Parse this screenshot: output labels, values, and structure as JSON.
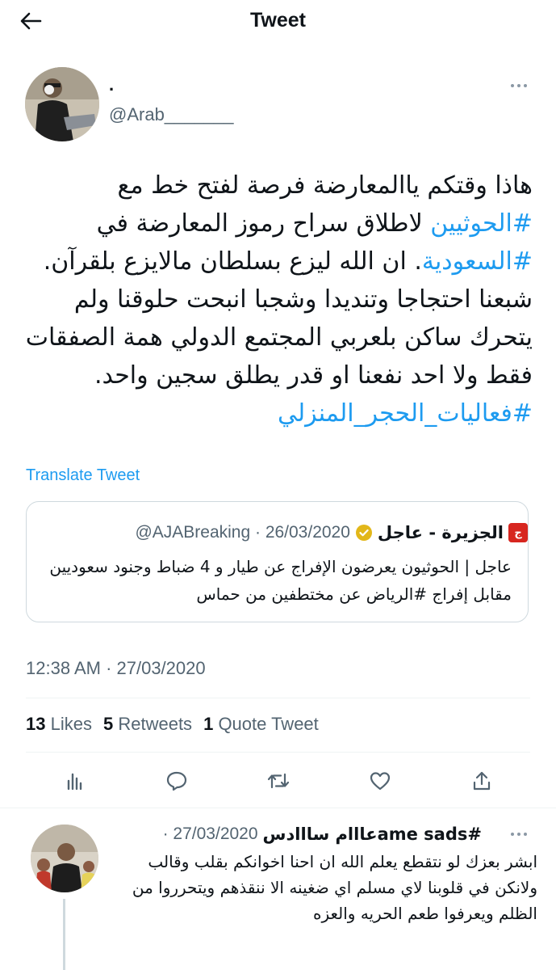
{
  "header": {
    "title": "Tweet"
  },
  "author": {
    "name": ".",
    "handle": "@Arab_______"
  },
  "tweet": {
    "segments": [
      {
        "text": "هاذا وقتكم ياالمعارضة فرصة لفتح خط مع ",
        "tag": false
      },
      {
        "text": "#الحوثيين",
        "tag": true
      },
      {
        "text": " لاطلاق سراح رموز المعارضة في ",
        "tag": false
      },
      {
        "text": "#السعودية",
        "tag": true
      },
      {
        "text": ". ان الله ليزع بسلطان مالايزع بلقرآن. شبعنا احتجاجا وتنديدا وشجبا انبحت حلوقنا ولم يتحرك ساكن بلعربي المجتمع الدولي همة الصفقات فقط ولا احد نفعنا او قدر يطلق سجين واحد. ",
        "tag": false
      },
      {
        "text": "#فعاليات_الحجر_المنزلي",
        "tag": true
      }
    ],
    "translate_label": "Translate Tweet",
    "timestamp": "12:38 AM · 27/03/2020",
    "stats": {
      "likes_count": "13",
      "likes_label": "Likes",
      "retweets_count": "5",
      "retweets_label": "Retweets",
      "quotes_count": "1",
      "quotes_label": "Quote Tweet"
    }
  },
  "quote": {
    "logo_text": "ج",
    "name": "الجزيرة - عاجل",
    "meta": "@AJABreaking · 26/03/2020",
    "text": "عاجل | الحوثيون يعرضون الإفراج عن طيار و 4 ضباط وجنود سعوديين مقابل إفراج #الرياض عن مختطفين من حماس"
  },
  "actions": [
    "analytics-icon",
    "reply-icon",
    "retweet-icon",
    "like-icon",
    "share-icon"
  ],
  "reply": {
    "name": "#ame sadsعااام سااادس",
    "date": "· 27/03/2020",
    "text": "ابشر بعزك لو نتقطع يعلم الله ان احنا اخوانكم بقلب وقالب ولانكن في قلوبنا لاي مسلم اي ضغينه الا ننقذهم ويتحرروا من الظلم ويعرفوا طعم الحريه والعزه"
  },
  "colors": {
    "accent": "#1d9bf0",
    "muted": "#536471",
    "border": "#cfd9de",
    "brand_red": "#d7261f",
    "verified": "#e2b719"
  }
}
